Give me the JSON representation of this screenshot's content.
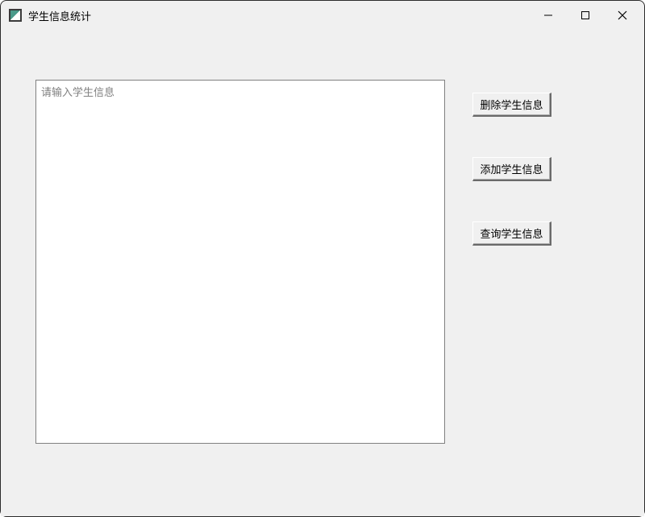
{
  "window": {
    "title": "学生信息统计"
  },
  "input": {
    "placeholder": "请输入学生信息",
    "value": ""
  },
  "buttons": {
    "delete": "删除学生信息",
    "add": "添加学生信息",
    "query": "查询学生信息"
  }
}
